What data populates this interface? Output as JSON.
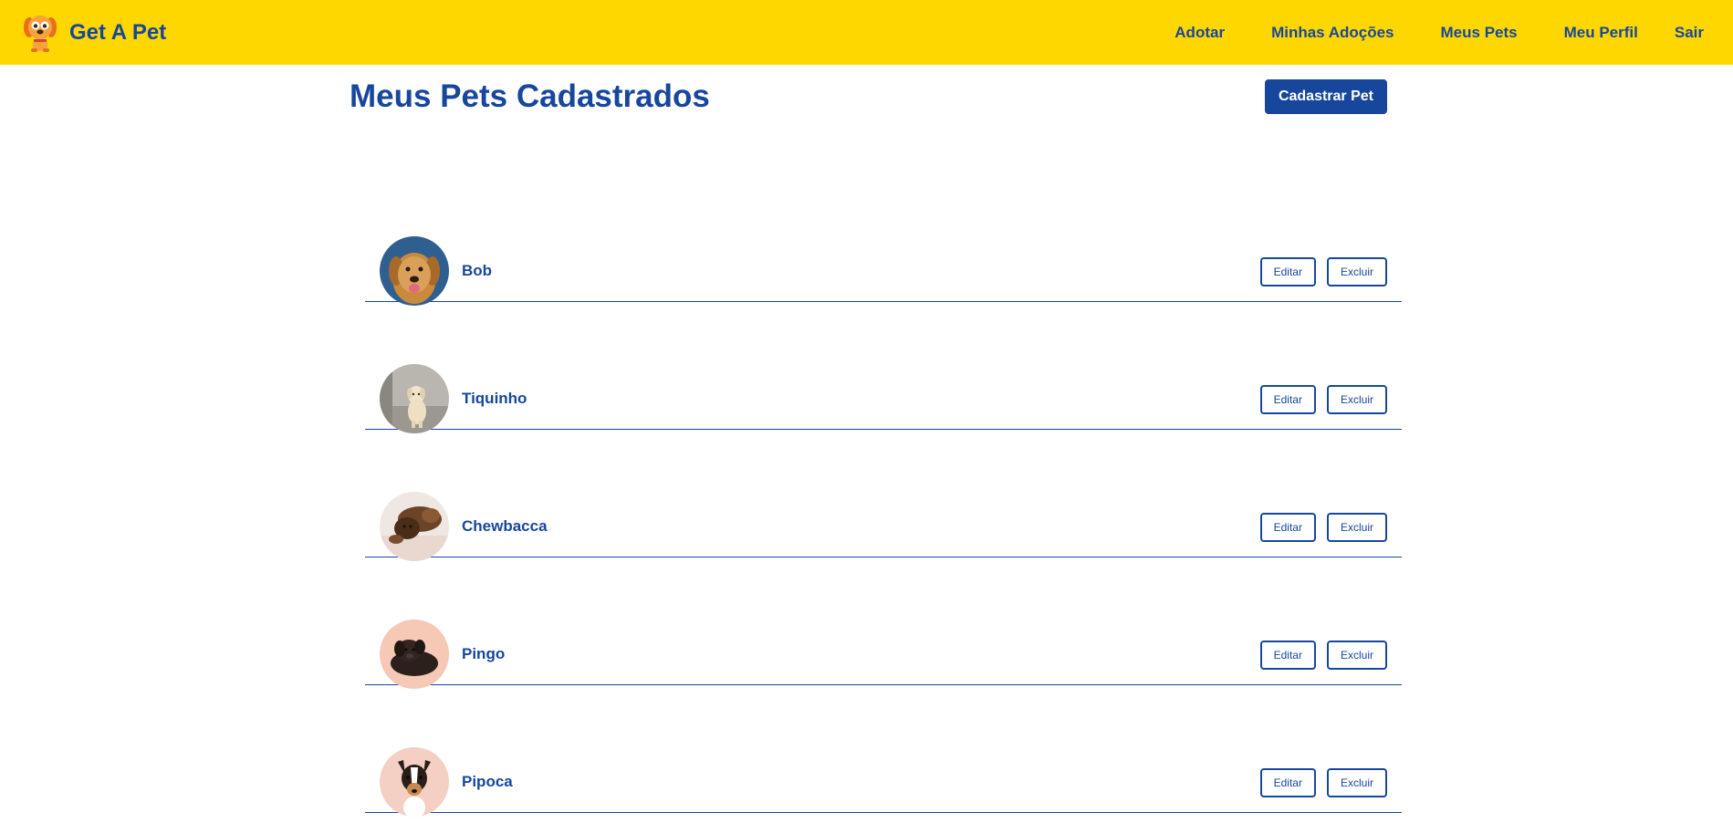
{
  "navbar": {
    "brand": "Get A Pet",
    "logo_icon": "dog-mascot-icon",
    "links": [
      "Adotar",
      "Minhas Adoções",
      "Meus Pets",
      "Meu Perfil",
      "Sair"
    ]
  },
  "page": {
    "title": "Meus Pets Cadastrados",
    "add_button": "Cadastrar Pet"
  },
  "pets": [
    {
      "name": "Bob",
      "edit": "Editar",
      "delete": "Excluir",
      "photo": "golden-retriever-photo"
    },
    {
      "name": "Tiquinho",
      "edit": "Editar",
      "delete": "Excluir",
      "photo": "puppy-photo"
    },
    {
      "name": "Chewbacca",
      "edit": "Editar",
      "delete": "Excluir",
      "photo": "fluffy-dog-photo"
    },
    {
      "name": "Pingo",
      "edit": "Editar",
      "delete": "Excluir",
      "photo": "black-puppy-photo"
    },
    {
      "name": "Pipoca",
      "edit": "Editar",
      "delete": "Excluir",
      "photo": "terrier-photo"
    }
  ],
  "colors": {
    "navbar_bg": "#FFD700",
    "primary": "#16479d"
  }
}
